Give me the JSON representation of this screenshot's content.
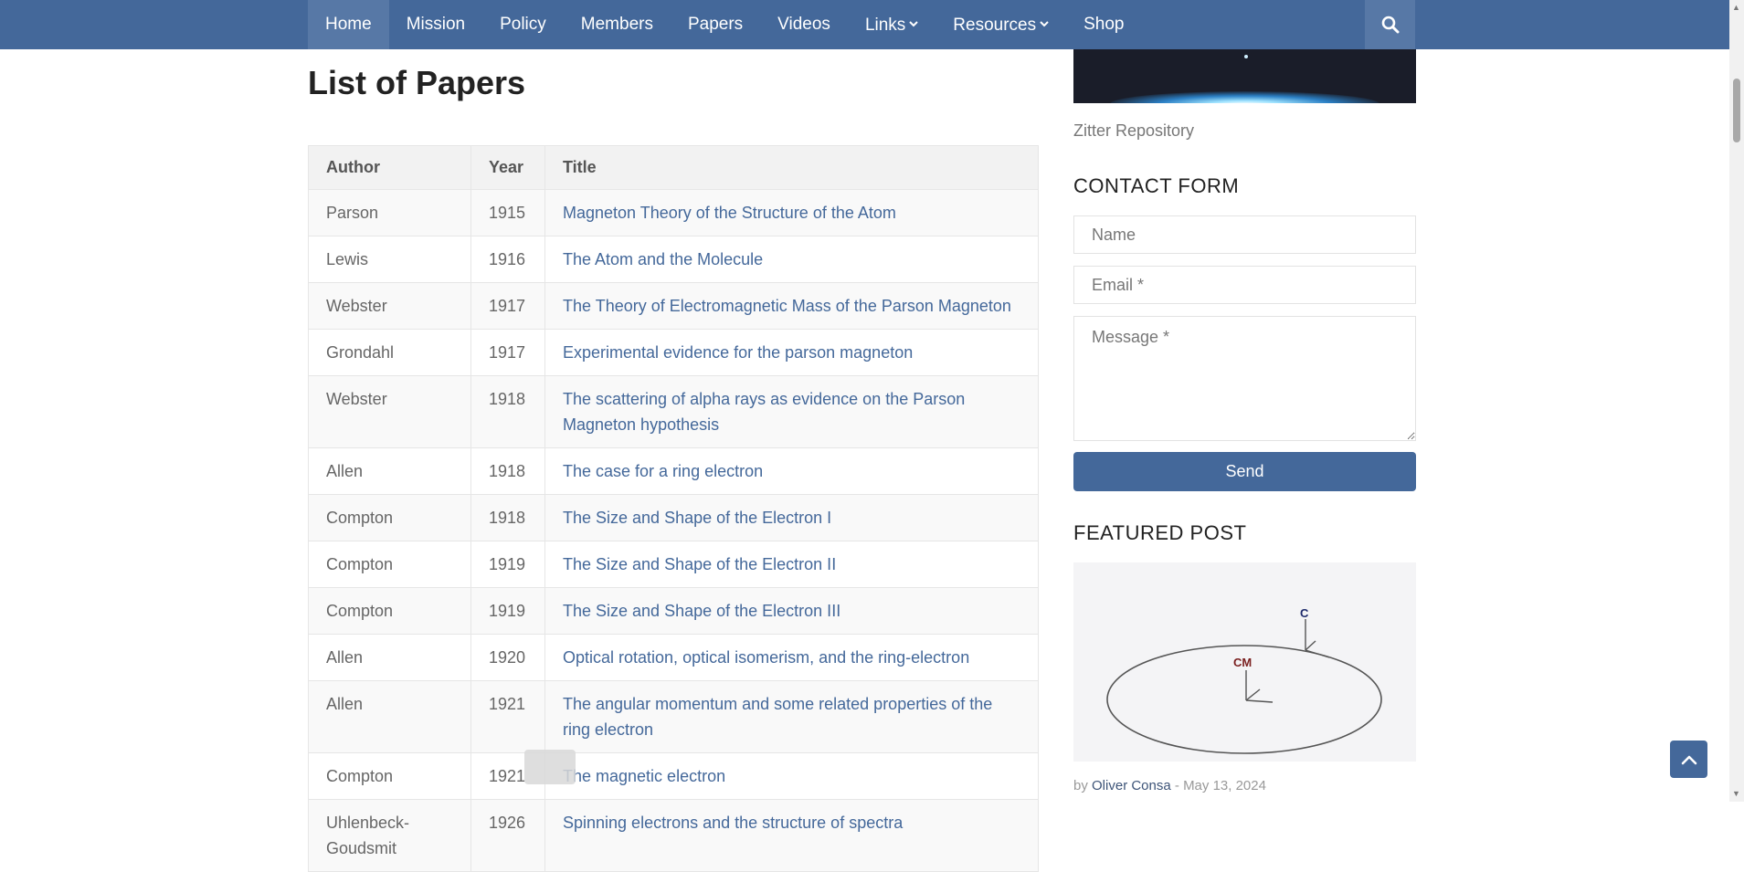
{
  "nav": {
    "items": [
      {
        "label": "Home",
        "dropdown": false
      },
      {
        "label": "Mission",
        "dropdown": false
      },
      {
        "label": "Policy",
        "dropdown": false
      },
      {
        "label": "Members",
        "dropdown": false
      },
      {
        "label": "Papers",
        "dropdown": false
      },
      {
        "label": "Videos",
        "dropdown": false
      },
      {
        "label": "Links",
        "dropdown": true
      },
      {
        "label": "Resources",
        "dropdown": true
      },
      {
        "label": "Shop",
        "dropdown": false
      }
    ],
    "active": "Home",
    "search_icon": "search-icon"
  },
  "main": {
    "title": "List of Papers",
    "table": {
      "headers": [
        "Author",
        "Year",
        "Title"
      ],
      "rows": [
        {
          "author": "Parson",
          "year": "1915",
          "title": "Magneton Theory of the Structure of the Atom"
        },
        {
          "author": "Lewis",
          "year": "1916",
          "title": "The Atom and the Molecule"
        },
        {
          "author": "Webster",
          "year": "1917",
          "title": "The Theory of Electromagnetic Mass of the Parson Magneton"
        },
        {
          "author": "Grondahl",
          "year": "1917",
          "title": "Experimental evidence for the parson magneton"
        },
        {
          "author": "Webster",
          "year": "1918",
          "title": "The scattering of alpha rays as evidence on the Parson Magneton hypothesis"
        },
        {
          "author": "Allen",
          "year": "1918",
          "title": "The case for a ring electron"
        },
        {
          "author": "Compton",
          "year": "1918",
          "title": "The Size and Shape of the Electron I"
        },
        {
          "author": "Compton",
          "year": "1919",
          "title": "The Size and Shape of the Electron II"
        },
        {
          "author": "Compton",
          "year": "1919",
          "title": "The Size and Shape of the Electron III"
        },
        {
          "author": "Allen",
          "year": "1920",
          "title": "Optical rotation, optical isomerism, and the ring-electron"
        },
        {
          "author": "Allen",
          "year": "1921",
          "title": "The angular momentum and some related properties of the ring electron"
        },
        {
          "author": "Compton",
          "year": "1921",
          "title": "The magnetic electron"
        },
        {
          "author": "Uhlenbeck-Goudsmit",
          "year": "1926",
          "title": "Spinning electrons and the structure of spectra"
        }
      ]
    }
  },
  "sidebar": {
    "image_caption": "Zitter Repository",
    "contact": {
      "title": "CONTACT FORM",
      "name_placeholder": "Name",
      "email_placeholder": "Email *",
      "message_placeholder": "Message *",
      "send_label": "Send"
    },
    "featured": {
      "title": "FEATURED POST",
      "label_cm": "CM",
      "label_c": "C",
      "by": "by",
      "author": "Oliver Consa",
      "separator": "-",
      "date": "May 13, 2024"
    }
  },
  "colors": {
    "brand": "#44689a",
    "nav_active": "#5778a6",
    "link": "#44689a"
  }
}
